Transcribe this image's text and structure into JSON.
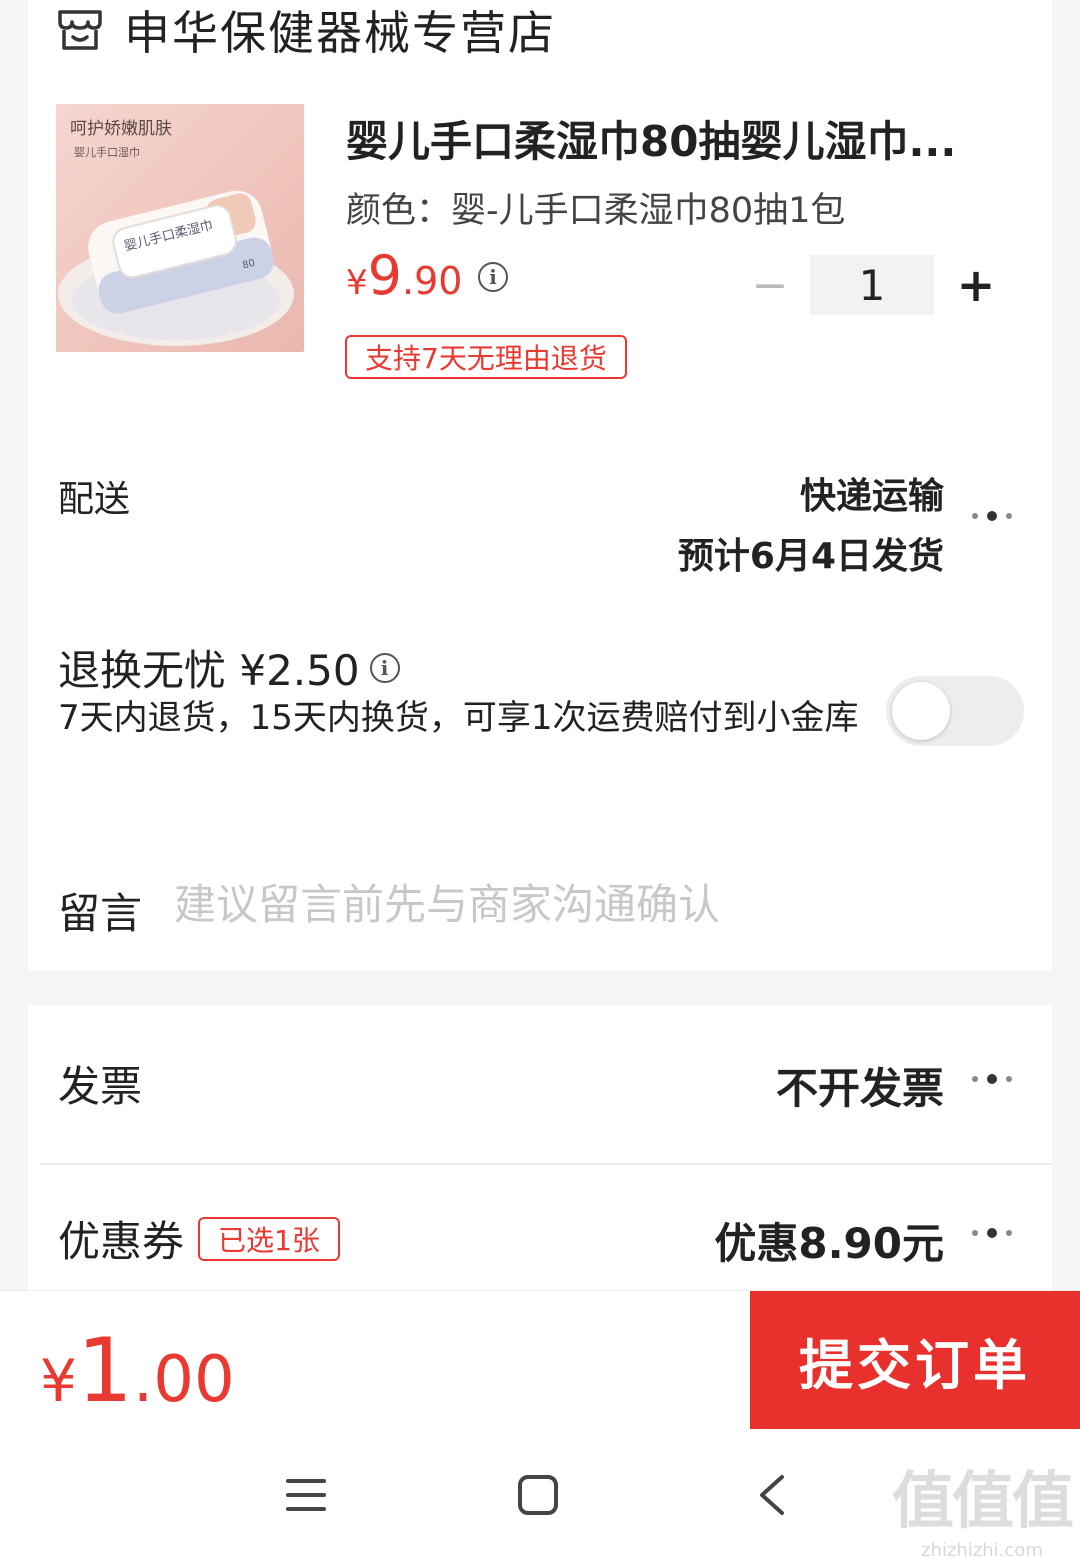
{
  "store": {
    "name": "申华保健器械专营店",
    "icon": "store-icon"
  },
  "product": {
    "image_text_1": "呵护娇嫩肌肤",
    "image_text_2": "婴儿手口湿巾",
    "image_text_pack": "婴儿手口柔湿巾",
    "image_text_count": "80",
    "title": "婴儿手口柔湿巾80抽婴儿湿巾...",
    "color_spec": "颜色：婴-儿手口柔湿巾80抽1包",
    "price_currency": "¥",
    "price_int": "9",
    "price_dec": ".90",
    "quantity": "1",
    "minus": "−",
    "plus": "+",
    "return_tag": "支持7天无理由退货"
  },
  "shipping": {
    "label": "配送",
    "method": "快递运输",
    "estimate": "预计6月4日发货"
  },
  "worry_free": {
    "title": "退换无忧 ¥2.50",
    "desc": "7天内退货，15天内换货，可享1次运费赔付到小金库",
    "enabled": false
  },
  "message": {
    "label": "留言",
    "placeholder": "建议留言前先与商家沟通确认"
  },
  "invoice": {
    "label": "发票",
    "value": "不开发票"
  },
  "coupon": {
    "label": "优惠券",
    "tag": "已选1张",
    "value": "优惠8.90元"
  },
  "bottom": {
    "currency": "¥",
    "total_int": "1",
    "total_dec": ".00",
    "submit": "提交订单"
  },
  "watermark": {
    "main": "值值值",
    "site": "zhizhizhi.com"
  },
  "colors": {
    "accent": "#e83a30",
    "submit_bg": "#e8302c"
  }
}
